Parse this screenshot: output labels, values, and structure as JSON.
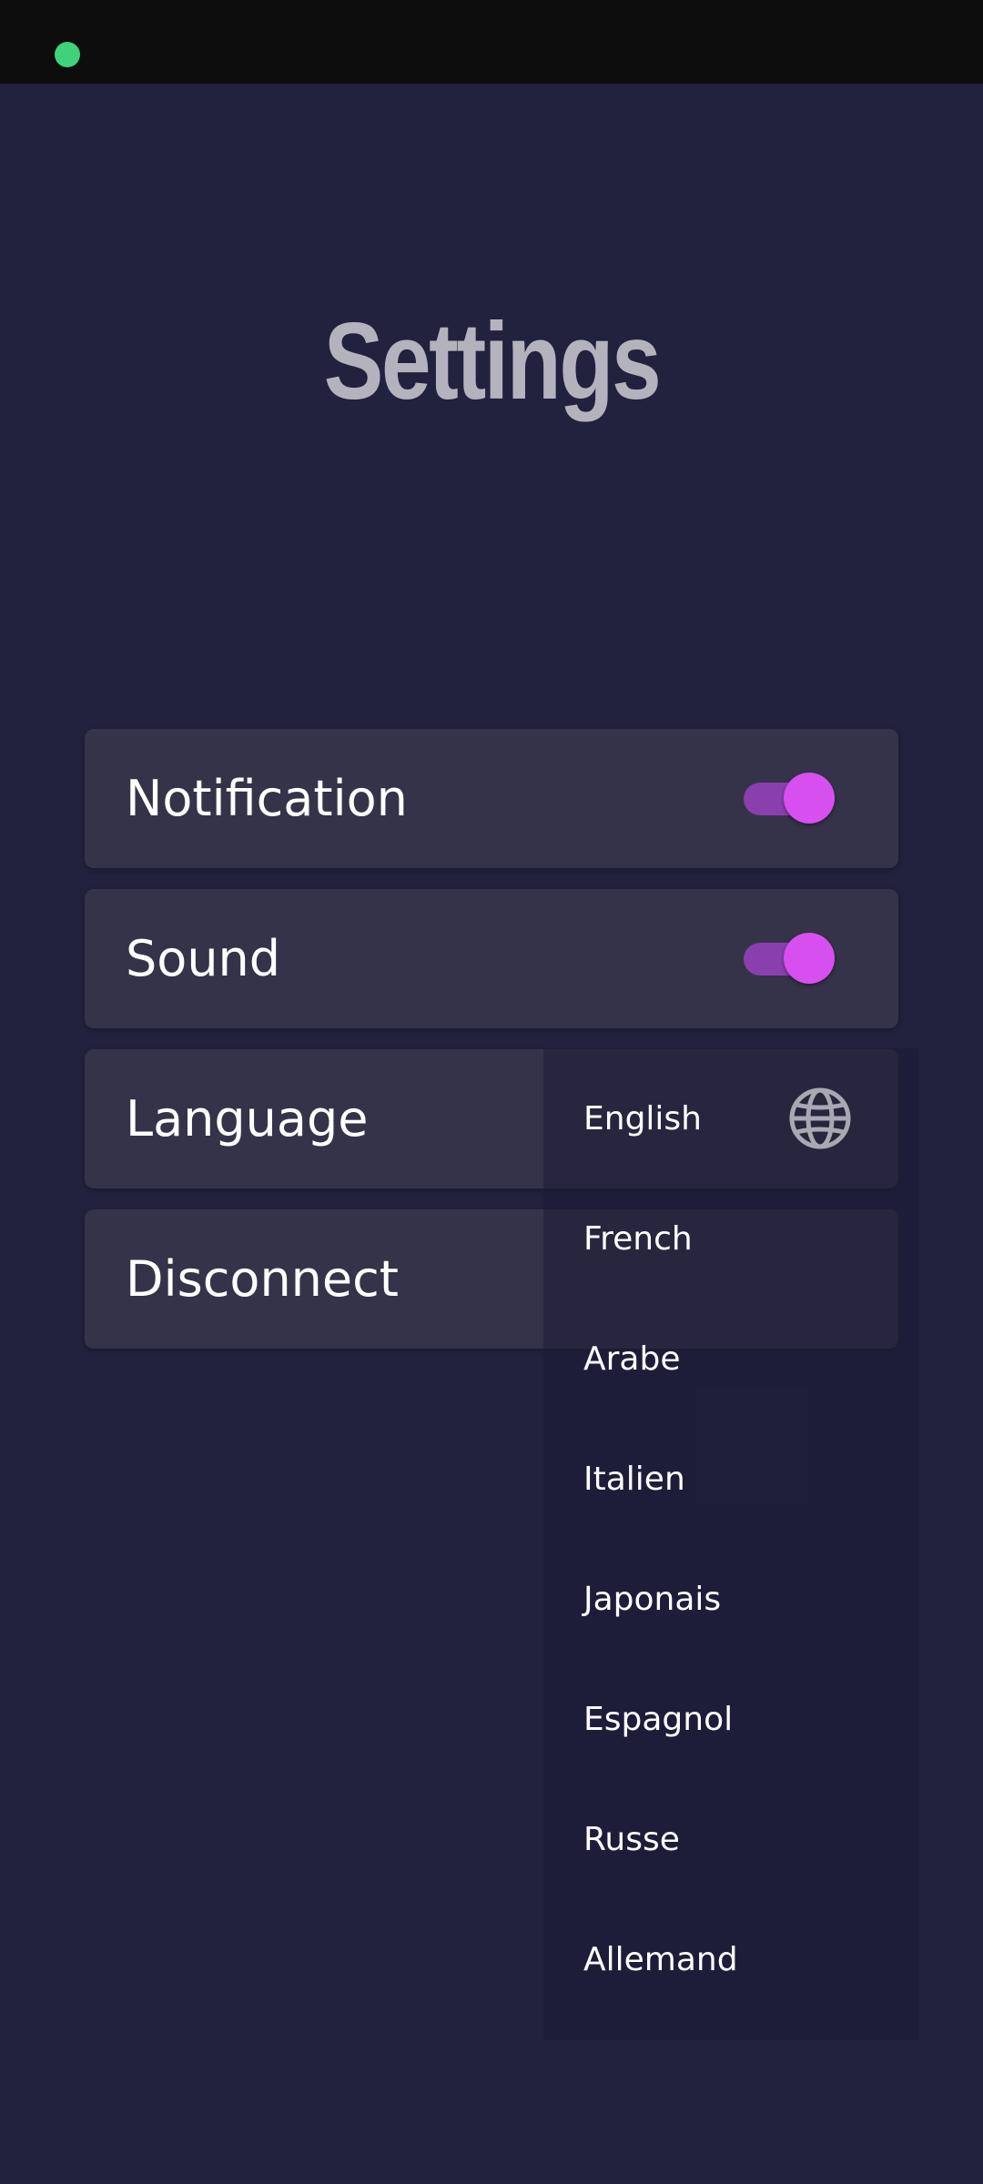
{
  "page": {
    "title": "Settings"
  },
  "colors": {
    "background": "#22213e",
    "card": "#35334a",
    "accent": "#d84ff0",
    "toggle_track": "#8a3fae",
    "status_dot": "#3fd27a",
    "title": "#b4b3bd"
  },
  "settings": {
    "notification": {
      "label": "Notification",
      "enabled": true
    },
    "sound": {
      "label": "Sound",
      "enabled": true
    },
    "language": {
      "label": "Language",
      "selected": "English",
      "icon": "globe-icon"
    },
    "disconnect": {
      "label": "Disconnect"
    }
  },
  "language_options": [
    "English",
    "French",
    "Arabe",
    "Italien",
    "Japonais",
    "Espagnol",
    "Russe",
    "Allemand"
  ]
}
